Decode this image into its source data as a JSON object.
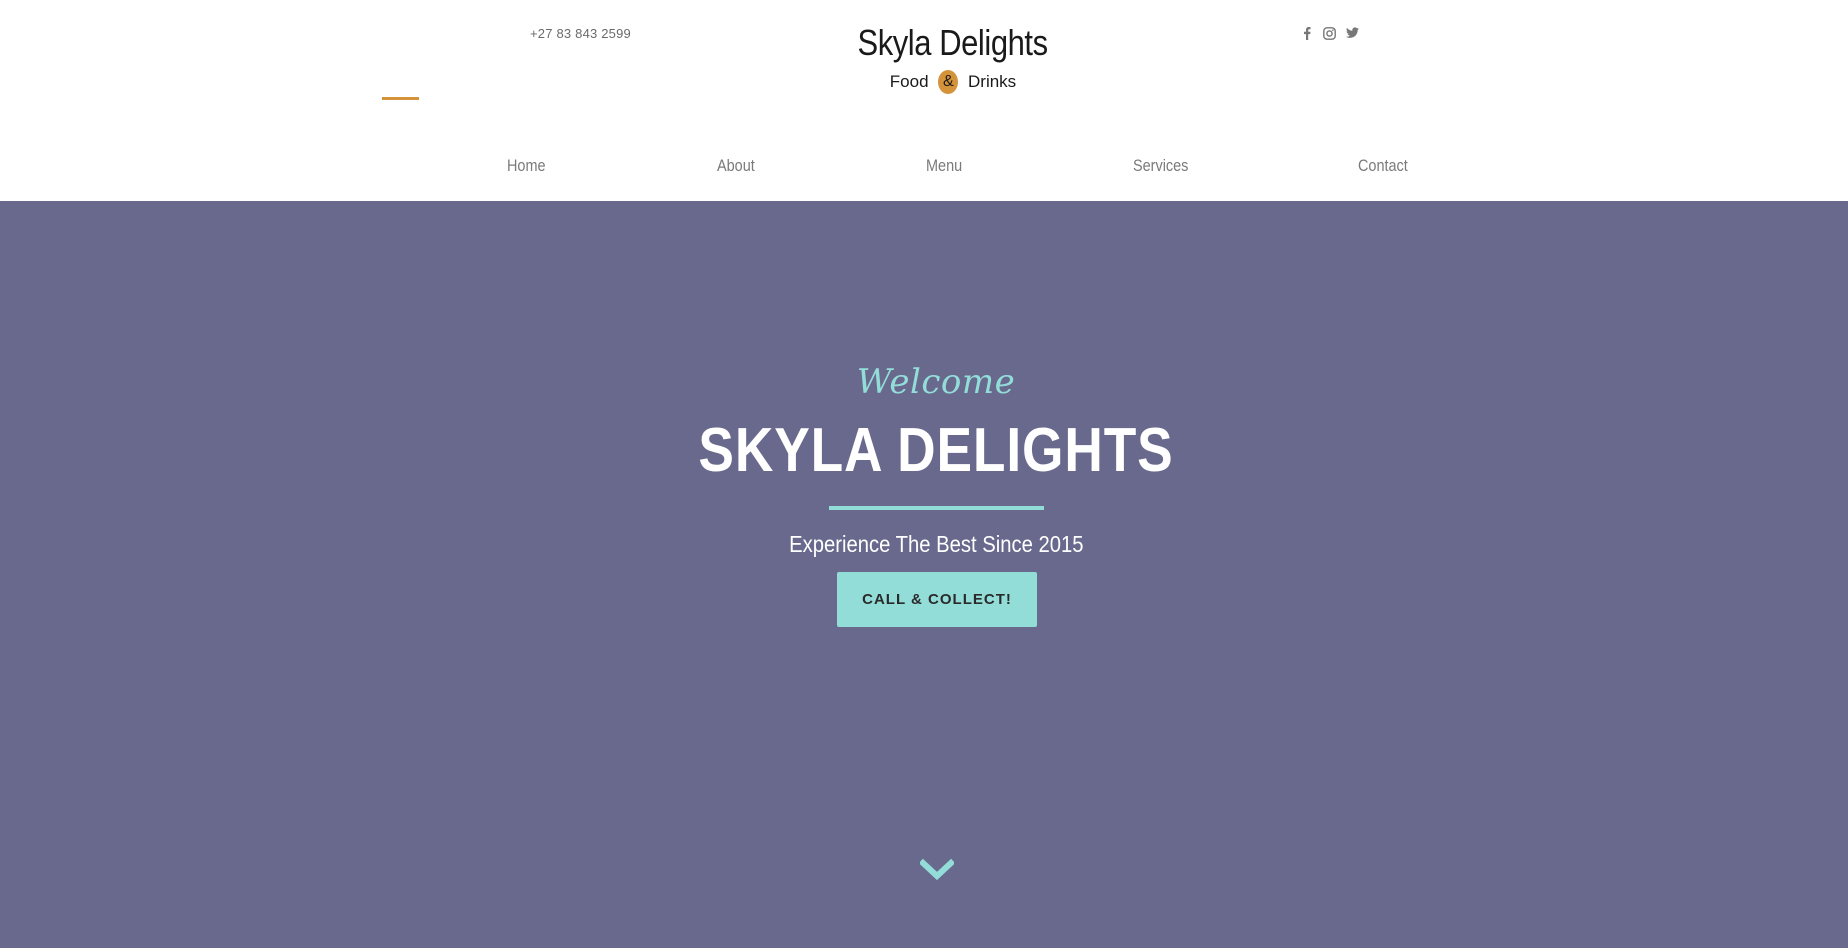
{
  "header": {
    "phone": "+27 83 843 2599",
    "brand_title": "Skyla Delights",
    "brand_sub_left": "Food",
    "brand_sub_amp": "&",
    "brand_sub_right": "Drinks",
    "social": [
      "facebook-icon",
      "instagram-icon",
      "twitter-icon"
    ],
    "accent_color": "#d4923a"
  },
  "nav": {
    "items": [
      {
        "label": "Home"
      },
      {
        "label": "About"
      },
      {
        "label": "Menu"
      },
      {
        "label": "Services"
      },
      {
        "label": "Contact"
      }
    ]
  },
  "hero": {
    "welcome": "Welcome",
    "title": "SKYLA DELIGHTS",
    "tagline": "Experience The Best Since 2015",
    "cta_label": "CALL & COLLECT!",
    "background": "#69698d",
    "accent": "#93ddd9",
    "scroll_icon": "chevron-down-icon"
  }
}
